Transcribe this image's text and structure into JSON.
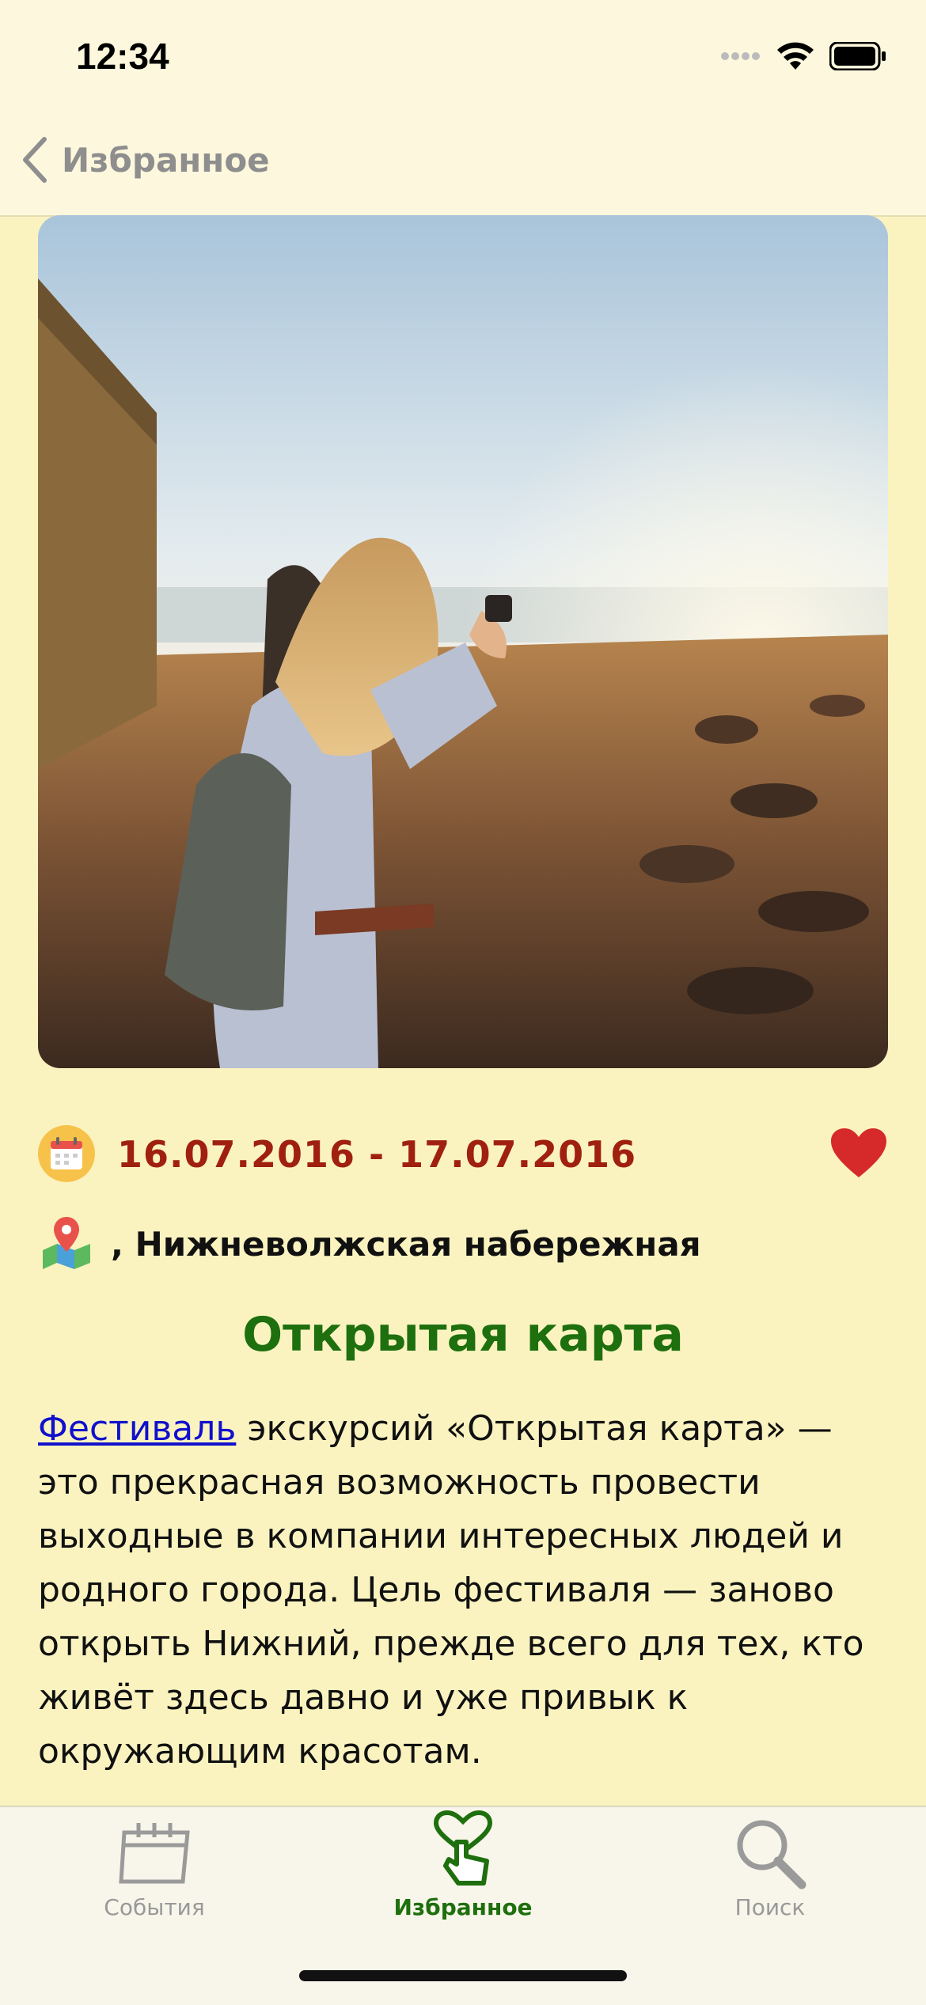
{
  "status_bar": {
    "time": "12:34"
  },
  "nav": {
    "back_label": "Избранное"
  },
  "event": {
    "dates": "16.07.2016 - 17.07.2016",
    "location": ", Нижневолжская набережная",
    "title": "Открытая карта",
    "description_link": "Фестиваль",
    "description_rest": " экскурсий «Открытая карта» — это прекрасная возможность провести выходные в компании интересных людей и родного города. Цель фестиваля — заново открыть Нижний, прежде всего для тех, кто живёт здесь давно и уже привык к окружающим красотам.",
    "favorited": true
  },
  "tabs": [
    {
      "label": "События",
      "icon": "calendar-icon",
      "active": false
    },
    {
      "label": "Избранное",
      "icon": "heart-hand-icon",
      "active": true
    },
    {
      "label": "Поиск",
      "icon": "search-icon",
      "active": false
    }
  ],
  "colors": {
    "background": "#faf3c0",
    "date": "#a02010",
    "title": "#1e6f0e",
    "heart": "#d62a2a",
    "link": "#1010cc"
  }
}
